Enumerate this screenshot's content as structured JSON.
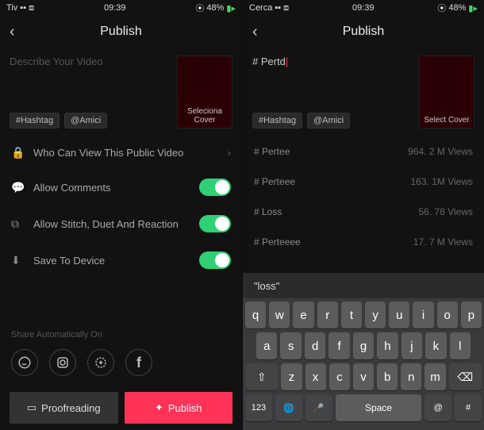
{
  "left": {
    "status": {
      "carrier": "Tiv",
      "time": "09:39",
      "battery": "48%"
    },
    "title": "Publish",
    "placeholder": "Describe Your Video",
    "tags": {
      "hashtag": "#Hashtag",
      "amici": "@Amici"
    },
    "cover": "Seleciona Cover",
    "view_row": "Who Can View This Public Video",
    "comments": "Allow Comments",
    "stitch": "Allow Stitch, Duet And Reaction",
    "save": "Save To Device",
    "share_label": "Share Automatically On",
    "draft_btn": "Proofreading",
    "publish_btn": "Publish"
  },
  "right": {
    "status": {
      "carrier": "Cerca",
      "time": "09:39",
      "battery": "48%"
    },
    "title": "Publish",
    "typed": "# Pertd",
    "tags": {
      "hashtag": "#Hashtag",
      "amici": "@Amici"
    },
    "cover": "Select Cover",
    "sugg": [
      {
        "tag": "# Pertee",
        "views": "964. 2 M Views"
      },
      {
        "tag": "# Perteee",
        "views": "163. 1M Views"
      },
      {
        "tag": "# Loss",
        "views": "56. 78 Views"
      },
      {
        "tag": "# Perteeee",
        "views": "17. 7 M Views"
      }
    ],
    "kb_sugg": "\"loss\"",
    "keys_r1": [
      "q",
      "w",
      "e",
      "r",
      "t",
      "y",
      "u",
      "i",
      "o",
      "p"
    ],
    "keys_r2": [
      "a",
      "s",
      "d",
      "f",
      "g",
      "h",
      "j",
      "k",
      "l"
    ],
    "keys_r3_mid": [
      "z",
      "x",
      "c",
      "v",
      "b",
      "n",
      "m"
    ],
    "space": "Space",
    "num": "123"
  }
}
